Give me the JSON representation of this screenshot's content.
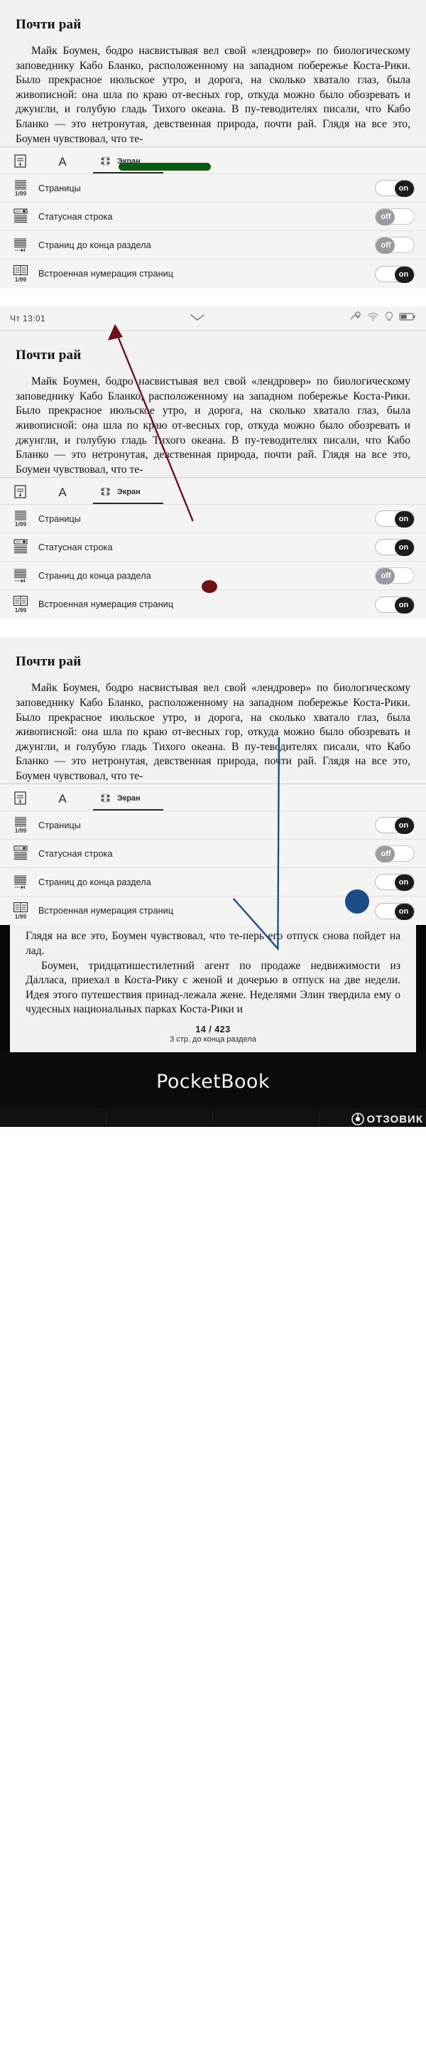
{
  "book": {
    "chapter_title": "Почти рай",
    "paragraph_1": "Майк Боумен, бодро насвистывая вел свой «лендровер» по биологическому заповеднику Кабо Бланко, расположенному на западном побережье Коста-Рики. Было прекрасное июльское утро, и дорога, на сколько хватало глаз, была живописной: она шла по краю от-весных гор, откуда можно было обозревать и джунгли, и голубую гладь Тихого океана. В пу-теводителях писали, что Кабо Бланко — это нетронутая, девственная природа, почти рай. Глядя на все это, Боумен чувствовал, что те-",
    "continuation_1": "Глядя на все это, Боумен чувствовал, что те-перь его отпуск снова пойдет на лад.",
    "continuation_2": "Боумен, тридцатишестилетний агент по продаже недвижимости из Далласа, приехал в Коста-Рику с женой и дочерью в отпуск на две недели. Идея этого путешествия принад-лежала жене. Неделями Элин твердила ему о чудесных национальных парках Коста-Рики и"
  },
  "status_bar": {
    "time": "Чт 13:01",
    "chevron_icon": "chevron-down-icon",
    "icons": [
      "sync-icon",
      "wifi-icon",
      "frontlight-bulb-icon",
      "battery-icon"
    ]
  },
  "settings": {
    "tabs": [
      {
        "label": "",
        "icon": "page-layout-icon",
        "active": false
      },
      {
        "label": "",
        "icon": "font-size-icon",
        "active": false
      },
      {
        "label": "Экран",
        "icon": "fullscreen-icon",
        "active": true
      }
    ],
    "rows": [
      {
        "label": "Страницы",
        "icon": "pages-icon",
        "icon_sub": "1/99",
        "state_1": "on",
        "state_2": "on",
        "state_3": "on"
      },
      {
        "label": "Статусная строка",
        "icon": "status-bar-icon",
        "icon_sub": "",
        "state_1": "off",
        "state_2": "on",
        "state_3": "off"
      },
      {
        "label": "Страниц до конца раздела",
        "icon": "pages-to-end-icon",
        "icon_sub": "",
        "state_1": "off",
        "state_2": "off",
        "state_3": "on"
      },
      {
        "label": "Встроенная нумерация страниц",
        "icon": "book-numbering-icon",
        "icon_sub": "1/99",
        "state_1": "on",
        "state_2": "on",
        "state_3": "on"
      }
    ],
    "toggle_on_label": "on",
    "toggle_off_label": "off"
  },
  "page_indicator": {
    "page": "14 / 423",
    "remaining": "3 стр. до конца раздела"
  },
  "device": {
    "brand": "PocketBook",
    "watermark": "ОТЗОВИК"
  },
  "colors": {
    "accent_green": "#0b5c11",
    "accent_blue": "#1c4e86",
    "accent_red": "#6e1118",
    "toggle_on_bg": "#1c1c1c",
    "toggle_off_bg": "#9a9aa3",
    "screen_bg": "#f1f1f0"
  }
}
